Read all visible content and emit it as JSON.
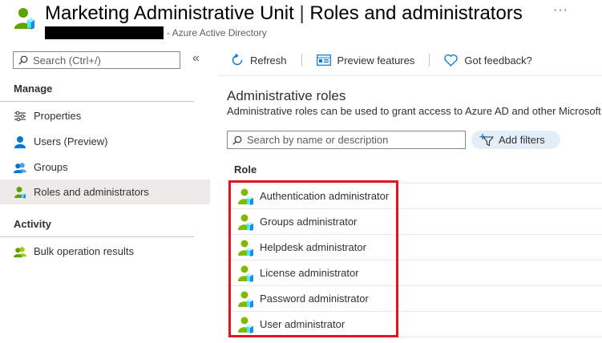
{
  "header": {
    "title": "Marketing Administrative Unit",
    "title_sep": " | ",
    "title_section": "Roles and administrators",
    "subtitle": "- Azure Active Directory",
    "more": "···"
  },
  "sidebar": {
    "search_placeholder": "Search (Ctrl+/)",
    "collapse": "«",
    "manage_label": "Manage",
    "items": [
      {
        "label": "Properties",
        "icon": "properties-icon"
      },
      {
        "label": "Users (Preview)",
        "icon": "user-icon"
      },
      {
        "label": "Groups",
        "icon": "groups-icon"
      },
      {
        "label": "Roles and administrators",
        "icon": "roles-icon",
        "active": true
      }
    ],
    "activity_label": "Activity",
    "activity_items": [
      {
        "label": "Bulk operation results",
        "icon": "bulk-icon"
      }
    ]
  },
  "toolbar": {
    "refresh": "Refresh",
    "preview": "Preview features",
    "feedback": "Got feedback?"
  },
  "content": {
    "title": "Administrative roles",
    "description": "Administrative roles can be used to grant access to Azure AD and other Microsoft",
    "search_placeholder": "Search by name or description",
    "add_filters": "Add filters",
    "column_role": "Role",
    "roles": [
      "Authentication administrator",
      "Groups administrator",
      "Helpdesk administrator",
      "License administrator",
      "Password administrator",
      "User administrator"
    ]
  },
  "colors": {
    "accent": "#0078d4",
    "highlight_border": "#e3161e",
    "active_nav": "#edebe9",
    "role_icon_green": "#7fba00"
  }
}
